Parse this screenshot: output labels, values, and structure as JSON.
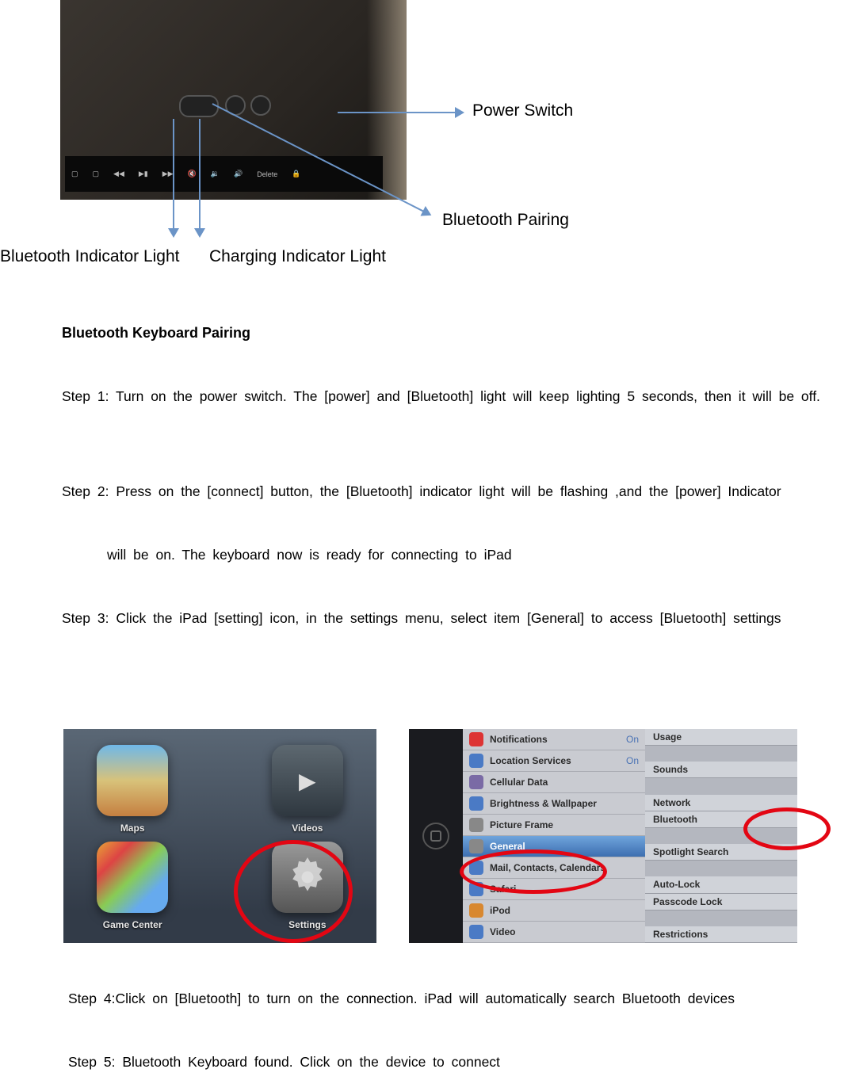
{
  "labels": {
    "power_switch": "Power Switch",
    "bluetooth_pairing": "Bluetooth Pairing",
    "bluetooth_indicator": "Bluetooth Indicator Light",
    "charging_indicator": "Charging Indicator Light"
  },
  "keyboard_keys": [
    "Delete"
  ],
  "section_title": "Bluetooth Keyboard Pairing",
  "steps": {
    "s1": "Step 1: Turn on the power switch. The [power] and [Bluetooth] light will keep lighting 5 seconds, then it will be off.",
    "s2": "Step 2: Press on the [connect] button, the [Bluetooth] indicator light will be flashing ,and the [power] Indicator",
    "s2b": "will be on. The keyboard now is ready for connecting to iPad",
    "s3": "Step 3: Click the iPad [setting] icon, in the settings menu, select item [General] to access [Bluetooth] settings",
    "s4": "Step 4:Click on [Bluetooth] to turn on the connection. iPad will automatically search Bluetooth  devices",
    "s5": "Step 5: Bluetooth Keyboard found. Click on the device to connect"
  },
  "ipad_home": {
    "maps": "Maps",
    "videos": "Videos",
    "gamecenter": "Game Center",
    "settings": "Settings"
  },
  "ipad_settings_left": [
    {
      "icon": "red",
      "label": "Notifications",
      "trailing": "On"
    },
    {
      "icon": "blue",
      "label": "Location Services",
      "trailing": "On"
    },
    {
      "icon": "purple",
      "label": "Cellular Data"
    },
    {
      "icon": "blue",
      "label": "Brightness & Wallpaper"
    },
    {
      "icon": "gray",
      "label": "Picture Frame"
    },
    {
      "icon": "gray",
      "label": "General",
      "selected": true
    },
    {
      "icon": "blue",
      "label": "Mail, Contacts, Calendars"
    },
    {
      "icon": "blue",
      "label": "Safari"
    },
    {
      "icon": "orange",
      "label": "iPod"
    },
    {
      "icon": "blue",
      "label": "Video"
    }
  ],
  "ipad_settings_right": [
    "Usage",
    "Sounds",
    "Network",
    "Bluetooth",
    "Spotlight Search",
    "Auto-Lock",
    "Passcode Lock",
    "Restrictions"
  ]
}
